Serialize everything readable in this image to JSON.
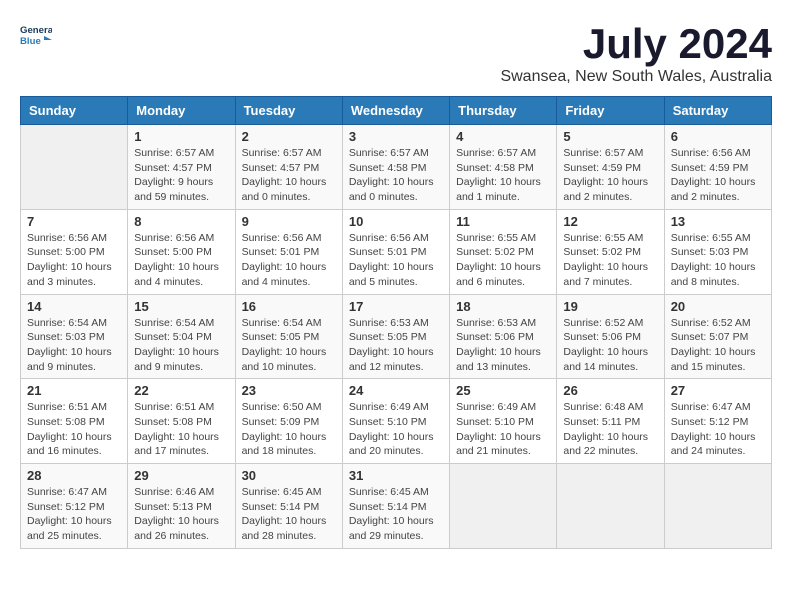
{
  "header": {
    "logo_line1": "General",
    "logo_line2": "Blue",
    "month": "July 2024",
    "location": "Swansea, New South Wales, Australia"
  },
  "weekdays": [
    "Sunday",
    "Monday",
    "Tuesday",
    "Wednesday",
    "Thursday",
    "Friday",
    "Saturday"
  ],
  "weeks": [
    [
      {
        "day": "",
        "info": ""
      },
      {
        "day": "1",
        "info": "Sunrise: 6:57 AM\nSunset: 4:57 PM\nDaylight: 9 hours\nand 59 minutes."
      },
      {
        "day": "2",
        "info": "Sunrise: 6:57 AM\nSunset: 4:57 PM\nDaylight: 10 hours\nand 0 minutes."
      },
      {
        "day": "3",
        "info": "Sunrise: 6:57 AM\nSunset: 4:58 PM\nDaylight: 10 hours\nand 0 minutes."
      },
      {
        "day": "4",
        "info": "Sunrise: 6:57 AM\nSunset: 4:58 PM\nDaylight: 10 hours\nand 1 minute."
      },
      {
        "day": "5",
        "info": "Sunrise: 6:57 AM\nSunset: 4:59 PM\nDaylight: 10 hours\nand 2 minutes."
      },
      {
        "day": "6",
        "info": "Sunrise: 6:56 AM\nSunset: 4:59 PM\nDaylight: 10 hours\nand 2 minutes."
      }
    ],
    [
      {
        "day": "7",
        "info": "Sunrise: 6:56 AM\nSunset: 5:00 PM\nDaylight: 10 hours\nand 3 minutes."
      },
      {
        "day": "8",
        "info": "Sunrise: 6:56 AM\nSunset: 5:00 PM\nDaylight: 10 hours\nand 4 minutes."
      },
      {
        "day": "9",
        "info": "Sunrise: 6:56 AM\nSunset: 5:01 PM\nDaylight: 10 hours\nand 4 minutes."
      },
      {
        "day": "10",
        "info": "Sunrise: 6:56 AM\nSunset: 5:01 PM\nDaylight: 10 hours\nand 5 minutes."
      },
      {
        "day": "11",
        "info": "Sunrise: 6:55 AM\nSunset: 5:02 PM\nDaylight: 10 hours\nand 6 minutes."
      },
      {
        "day": "12",
        "info": "Sunrise: 6:55 AM\nSunset: 5:02 PM\nDaylight: 10 hours\nand 7 minutes."
      },
      {
        "day": "13",
        "info": "Sunrise: 6:55 AM\nSunset: 5:03 PM\nDaylight: 10 hours\nand 8 minutes."
      }
    ],
    [
      {
        "day": "14",
        "info": "Sunrise: 6:54 AM\nSunset: 5:03 PM\nDaylight: 10 hours\nand 9 minutes."
      },
      {
        "day": "15",
        "info": "Sunrise: 6:54 AM\nSunset: 5:04 PM\nDaylight: 10 hours\nand 9 minutes."
      },
      {
        "day": "16",
        "info": "Sunrise: 6:54 AM\nSunset: 5:05 PM\nDaylight: 10 hours\nand 10 minutes."
      },
      {
        "day": "17",
        "info": "Sunrise: 6:53 AM\nSunset: 5:05 PM\nDaylight: 10 hours\nand 12 minutes."
      },
      {
        "day": "18",
        "info": "Sunrise: 6:53 AM\nSunset: 5:06 PM\nDaylight: 10 hours\nand 13 minutes."
      },
      {
        "day": "19",
        "info": "Sunrise: 6:52 AM\nSunset: 5:06 PM\nDaylight: 10 hours\nand 14 minutes."
      },
      {
        "day": "20",
        "info": "Sunrise: 6:52 AM\nSunset: 5:07 PM\nDaylight: 10 hours\nand 15 minutes."
      }
    ],
    [
      {
        "day": "21",
        "info": "Sunrise: 6:51 AM\nSunset: 5:08 PM\nDaylight: 10 hours\nand 16 minutes."
      },
      {
        "day": "22",
        "info": "Sunrise: 6:51 AM\nSunset: 5:08 PM\nDaylight: 10 hours\nand 17 minutes."
      },
      {
        "day": "23",
        "info": "Sunrise: 6:50 AM\nSunset: 5:09 PM\nDaylight: 10 hours\nand 18 minutes."
      },
      {
        "day": "24",
        "info": "Sunrise: 6:49 AM\nSunset: 5:10 PM\nDaylight: 10 hours\nand 20 minutes."
      },
      {
        "day": "25",
        "info": "Sunrise: 6:49 AM\nSunset: 5:10 PM\nDaylight: 10 hours\nand 21 minutes."
      },
      {
        "day": "26",
        "info": "Sunrise: 6:48 AM\nSunset: 5:11 PM\nDaylight: 10 hours\nand 22 minutes."
      },
      {
        "day": "27",
        "info": "Sunrise: 6:47 AM\nSunset: 5:12 PM\nDaylight: 10 hours\nand 24 minutes."
      }
    ],
    [
      {
        "day": "28",
        "info": "Sunrise: 6:47 AM\nSunset: 5:12 PM\nDaylight: 10 hours\nand 25 minutes."
      },
      {
        "day": "29",
        "info": "Sunrise: 6:46 AM\nSunset: 5:13 PM\nDaylight: 10 hours\nand 26 minutes."
      },
      {
        "day": "30",
        "info": "Sunrise: 6:45 AM\nSunset: 5:14 PM\nDaylight: 10 hours\nand 28 minutes."
      },
      {
        "day": "31",
        "info": "Sunrise: 6:45 AM\nSunset: 5:14 PM\nDaylight: 10 hours\nand 29 minutes."
      },
      {
        "day": "",
        "info": ""
      },
      {
        "day": "",
        "info": ""
      },
      {
        "day": "",
        "info": ""
      }
    ]
  ]
}
